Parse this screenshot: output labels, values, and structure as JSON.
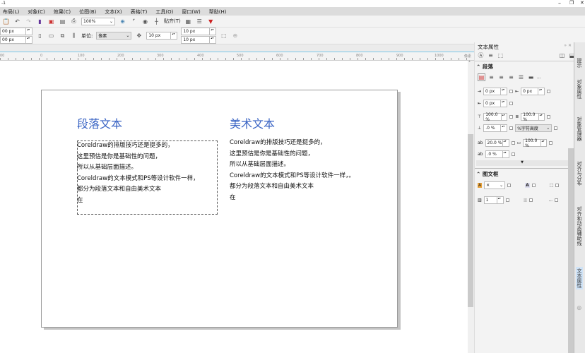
{
  "window": {
    "title": "-1"
  },
  "menu": [
    "布局(L)",
    "对象(C)",
    "效果(C)",
    "位图(B)",
    "文本(X)",
    "表格(T)",
    "工具(O)",
    "窗口(W)",
    "帮助(H)"
  ],
  "toolbar": {
    "zoom": "100%",
    "snap": "贴齐(T)"
  },
  "propbar": {
    "w": "00 px",
    "h": "00 px",
    "unit_label": "单位:",
    "unit": "像素",
    "nudge": "10 px",
    "dup_x": "10 px",
    "dup_y": "10 px"
  },
  "ruler": {
    "ticks": [
      "00",
      "0",
      "100",
      "200",
      "300",
      "400",
      "500",
      "600",
      "700",
      "800",
      "900",
      "1000"
    ],
    "unit": "像素"
  },
  "document": {
    "paragraph_title": "段落文本",
    "artistic_title": "美术文本",
    "paragraph_lines": [
      "Coreldraw的排版技巧还是挺多的，",
      "这里预估是你是基础性的问题，",
      "所以从基础层面描述。",
      "Coreldraw的文本模式和PS等设计软件一样，",
      "都分为段落文本和自由美术文本",
      "在"
    ],
    "artistic_lines": [
      "Coreldraw的排版技巧还是挺多的，",
      "这里预估是你是基础性的问题，",
      "所以从基础层面描述。",
      "Coreldraw的文本模式和PS等设计软件一样，。",
      "都分为段落文本和自由美术文本",
      "在"
    ]
  },
  "docker": {
    "title": "文本属性",
    "paragraph_section": "段落",
    "left_indent": "0 px",
    "first_indent": "0 px",
    "right_indent": "0 px",
    "line_before": "100.0 %",
    "line_spacing": "100.0 %",
    "after": ".0 %",
    "spacing_unit": "%字符高度",
    "char_spacing": "20.0 %",
    "word_spacing": "100.0 %",
    "lang_spacing": ".0 %",
    "frame_section": "图文框",
    "columns": "1",
    "more": "..."
  },
  "side_tabs": [
    "提示",
    "对象属性",
    "对象管理器",
    "对齐与分布",
    "对齐和动态辅助线",
    "文本属性"
  ]
}
